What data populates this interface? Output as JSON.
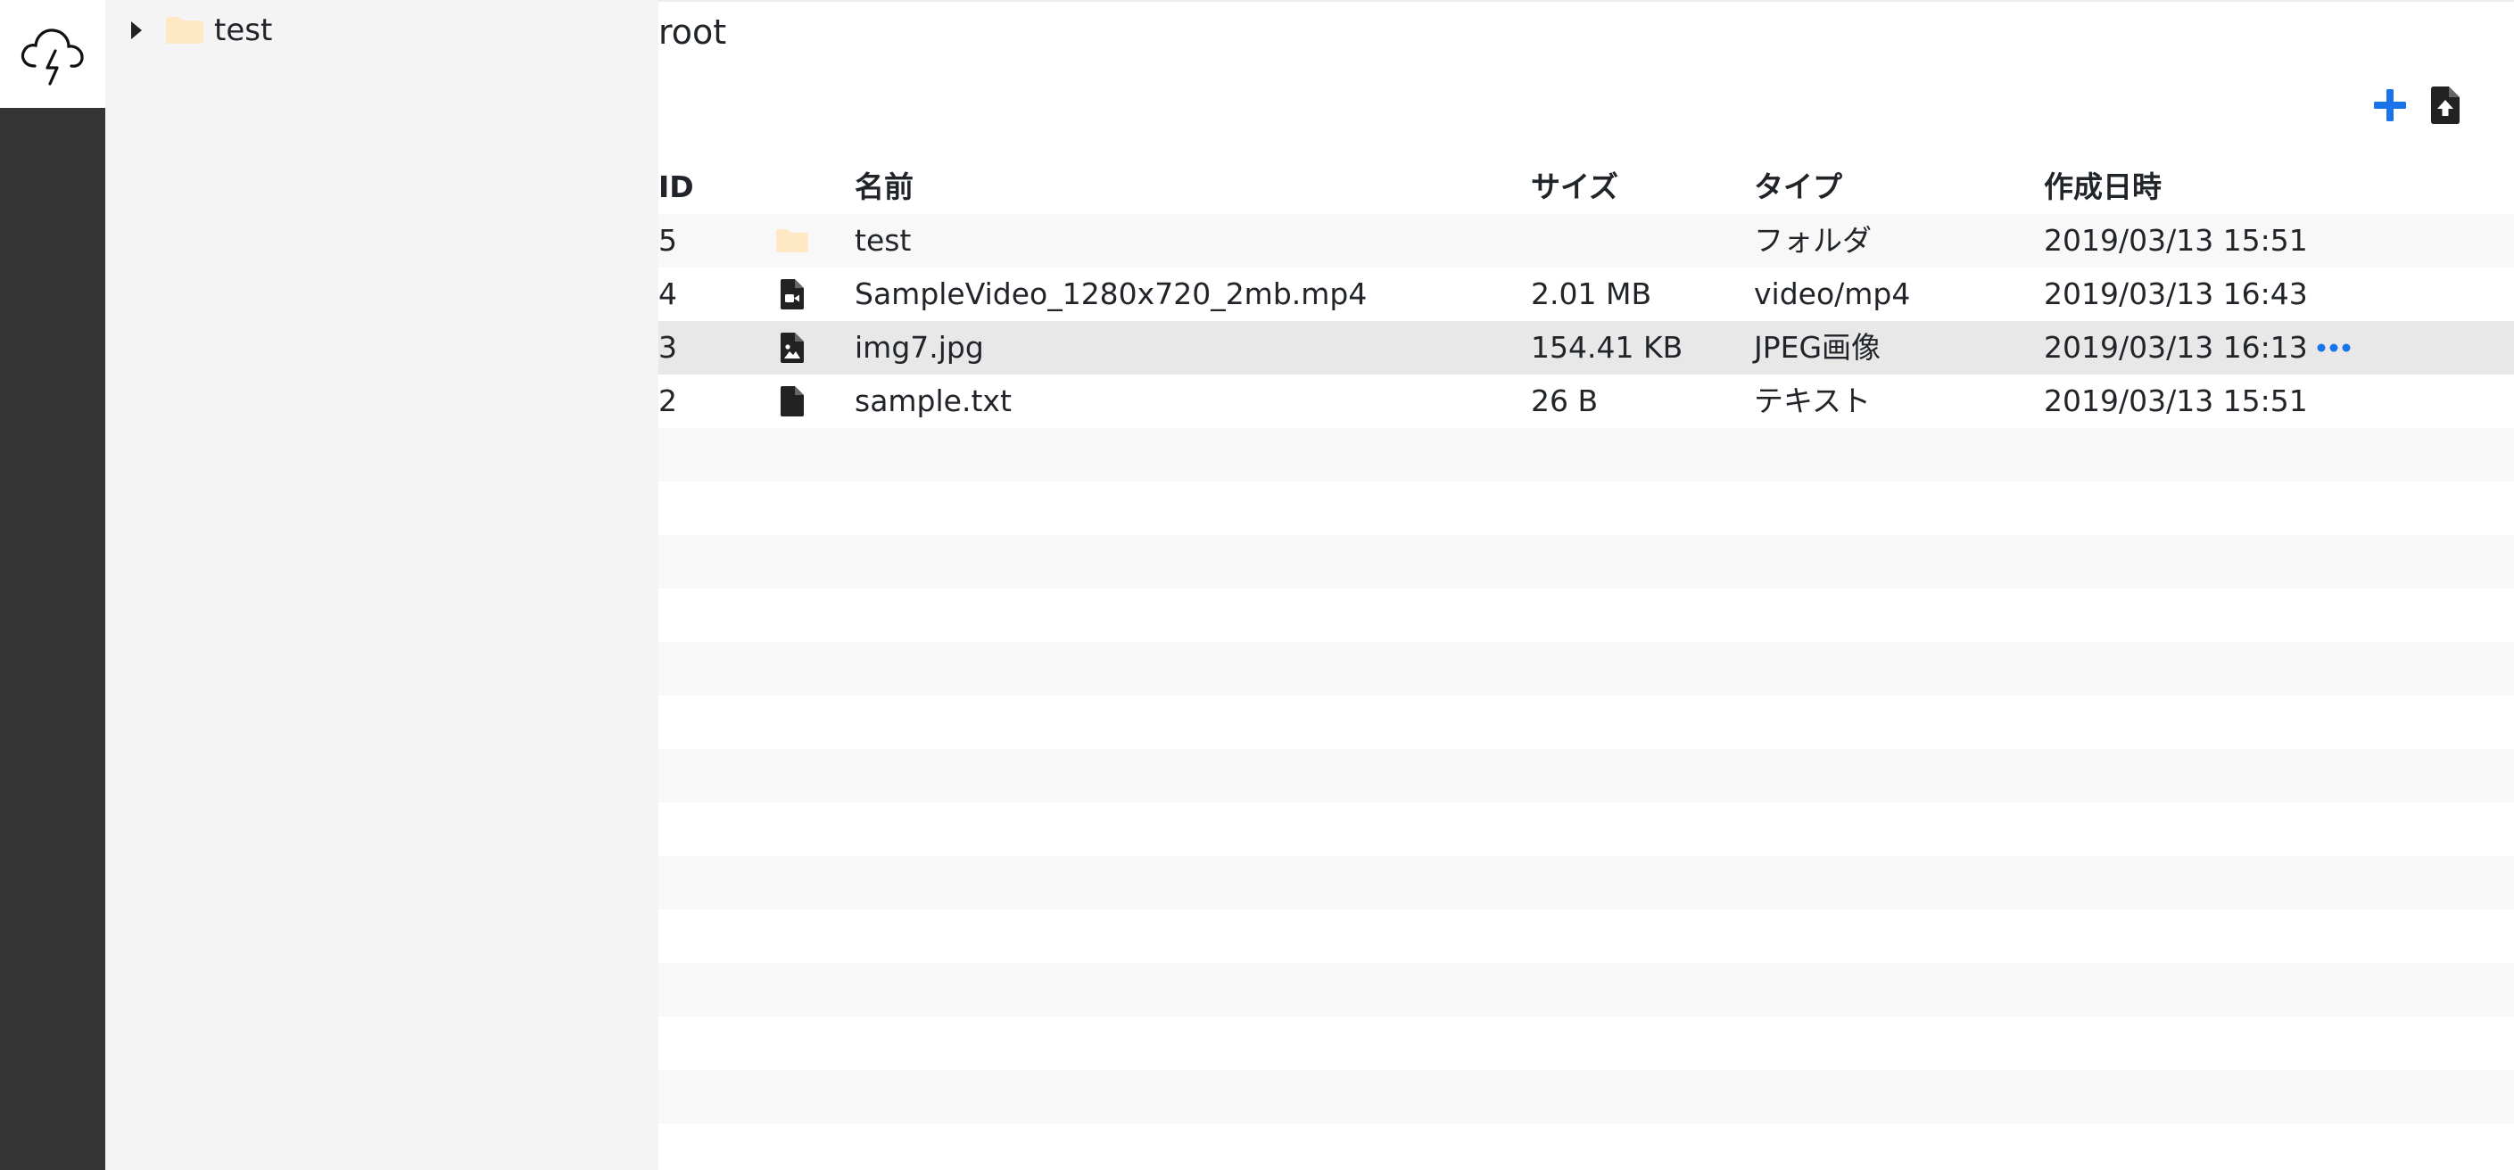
{
  "sidebar_tree": {
    "items": [
      {
        "label": "test",
        "icon": "folder-icon",
        "expand_icon": "caret-right-icon"
      }
    ]
  },
  "breadcrumb": {
    "current": "root"
  },
  "toolbar": {
    "add_icon": "plus-icon",
    "upload_icon": "file-upload-icon",
    "accent_color": "#1a73e8"
  },
  "table": {
    "columns": [
      "ID",
      "名前",
      "サイズ",
      "タイプ",
      "作成日時"
    ],
    "rows": [
      {
        "id": "5",
        "icon": "folder-icon",
        "name": "test",
        "size": "",
        "type": "フォルダ",
        "created": "2019/03/13 15:51"
      },
      {
        "id": "4",
        "icon": "video-file-icon",
        "name": "SampleVideo_1280x720_2mb.mp4",
        "size": "2.01 MB",
        "type": "video/mp4",
        "created": "2019/03/13 16:43"
      },
      {
        "id": "3",
        "icon": "image-file-icon",
        "name": "img7.jpg",
        "size": "154.41 KB",
        "type": "JPEG画像",
        "created": "2019/03/13 16:13",
        "more_icon": "more-horizontal-icon"
      },
      {
        "id": "2",
        "icon": "file-icon",
        "name": "sample.txt",
        "size": "26 B",
        "type": "テキスト",
        "created": "2019/03/13 15:51"
      }
    ]
  },
  "colors": {
    "rail": "#343434",
    "tree_bg": "#f4f4f4",
    "folder": "#ffe8c4",
    "stripe": "#f8f8f8",
    "hover_row": "#e8e8e8",
    "accent": "#1a73e8"
  }
}
